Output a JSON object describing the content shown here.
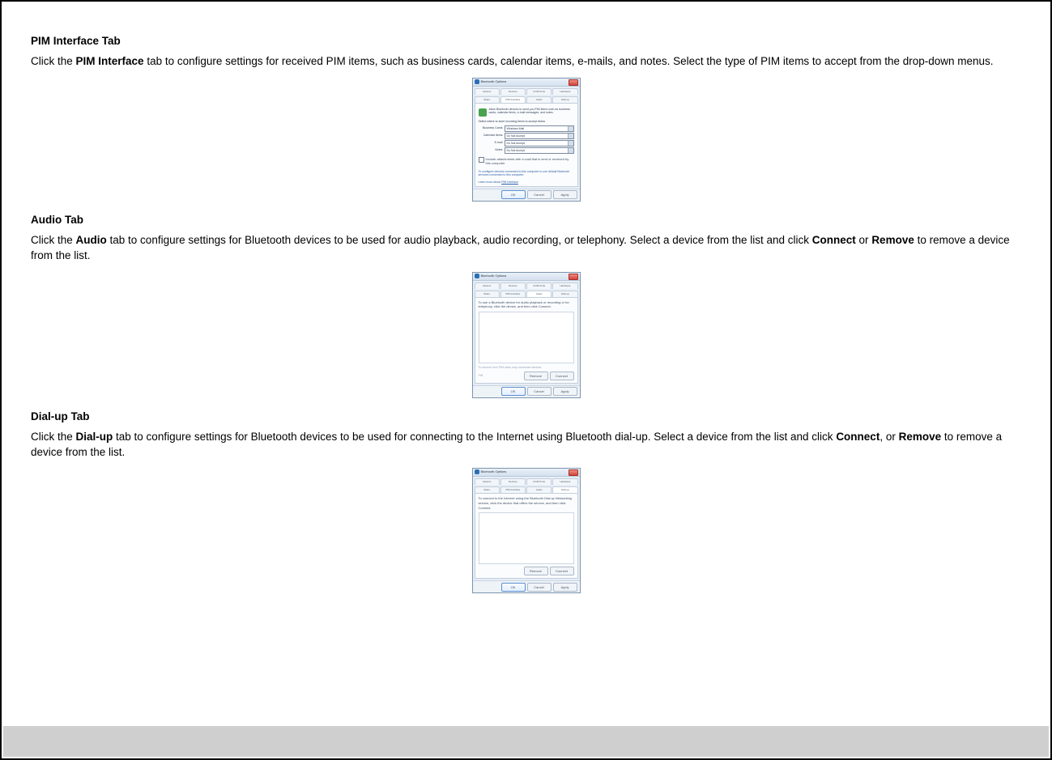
{
  "sections": {
    "pim": {
      "title": "PIM Interface Tab",
      "para_pre": "Click the ",
      "para_bold": "PIM Interface",
      "para_post": " tab to configure settings for received PIM items, such as business cards, calendar items, e-mails, and notes. Select the type of PIM items to accept from the drop-down menus."
    },
    "audio": {
      "title": "Audio Tab",
      "para_pre": "Click the ",
      "para_bold": "Audio",
      "para_post": " tab to configure settings for Bluetooth devices to be used for audio playback, audio recording, or telephony. Select a device from the list and click ",
      "para_bold2": "Connect",
      "para_or": " or ",
      "para_bold3": "Remove",
      "para_end": " to remove a device from the list."
    },
    "dialup": {
      "title": "Dial-up Tab",
      "para_pre": "Click the ",
      "para_bold": "Dial-up",
      "para_post": " tab to configure settings for Bluetooth devices to be used for connecting to the Internet using Bluetooth dial-up. Select a device from the list and click ",
      "para_bold2": "Connect",
      "para_or": ", or ",
      "para_bold3": "Remove",
      "para_end": " to remove a device from the list."
    }
  },
  "dialog": {
    "title": "Bluetooth Options",
    "tabs_top": [
      "Options",
      "Devices",
      "COM Ports",
      "Hardware"
    ],
    "tabs_bot": [
      "Share",
      "PIM Interface",
      "Audio",
      "Dial-up"
    ],
    "buttons": {
      "ok": "OK",
      "cancel": "Cancel",
      "apply": "Apply",
      "remove": "Remove",
      "connect": "Connect"
    },
    "pim": {
      "info": "Allow Bluetooth devices to send you PIM items such as business cards, calendar items, e-mail messages, and notes.",
      "section_label": "Select where to store incoming items to accept below",
      "rows": [
        {
          "label": "Business Cards",
          "value": "Windows Mail"
        },
        {
          "label": "Calendar Items",
          "value": "Do Not Accept"
        },
        {
          "label": "E-mail",
          "value": "Do Not Accept"
        },
        {
          "label": "Notes",
          "value": "Do Not Accept"
        }
      ],
      "checkbox": "Include attachments with e-mail that is sent or received by this computer",
      "config_text": "To configure devices connected to this computer to use default Bluetooth services connected to this computer.",
      "learn_pre": "Learn more about ",
      "learn_link": "PIM Interface"
    },
    "audio": {
      "info": "To use a Bluetooth device for audio playback or recording or for telephony, click the device, and then click Connect.",
      "footnote": "To remove from PIM allow only connected devices",
      "pin": "PIN"
    },
    "dialup": {
      "info": "To connect to the Internet using the Bluetooth Dial-up Networking service, click the device that offers the service, and then click Connect.",
      "active": "Dial-up"
    }
  }
}
